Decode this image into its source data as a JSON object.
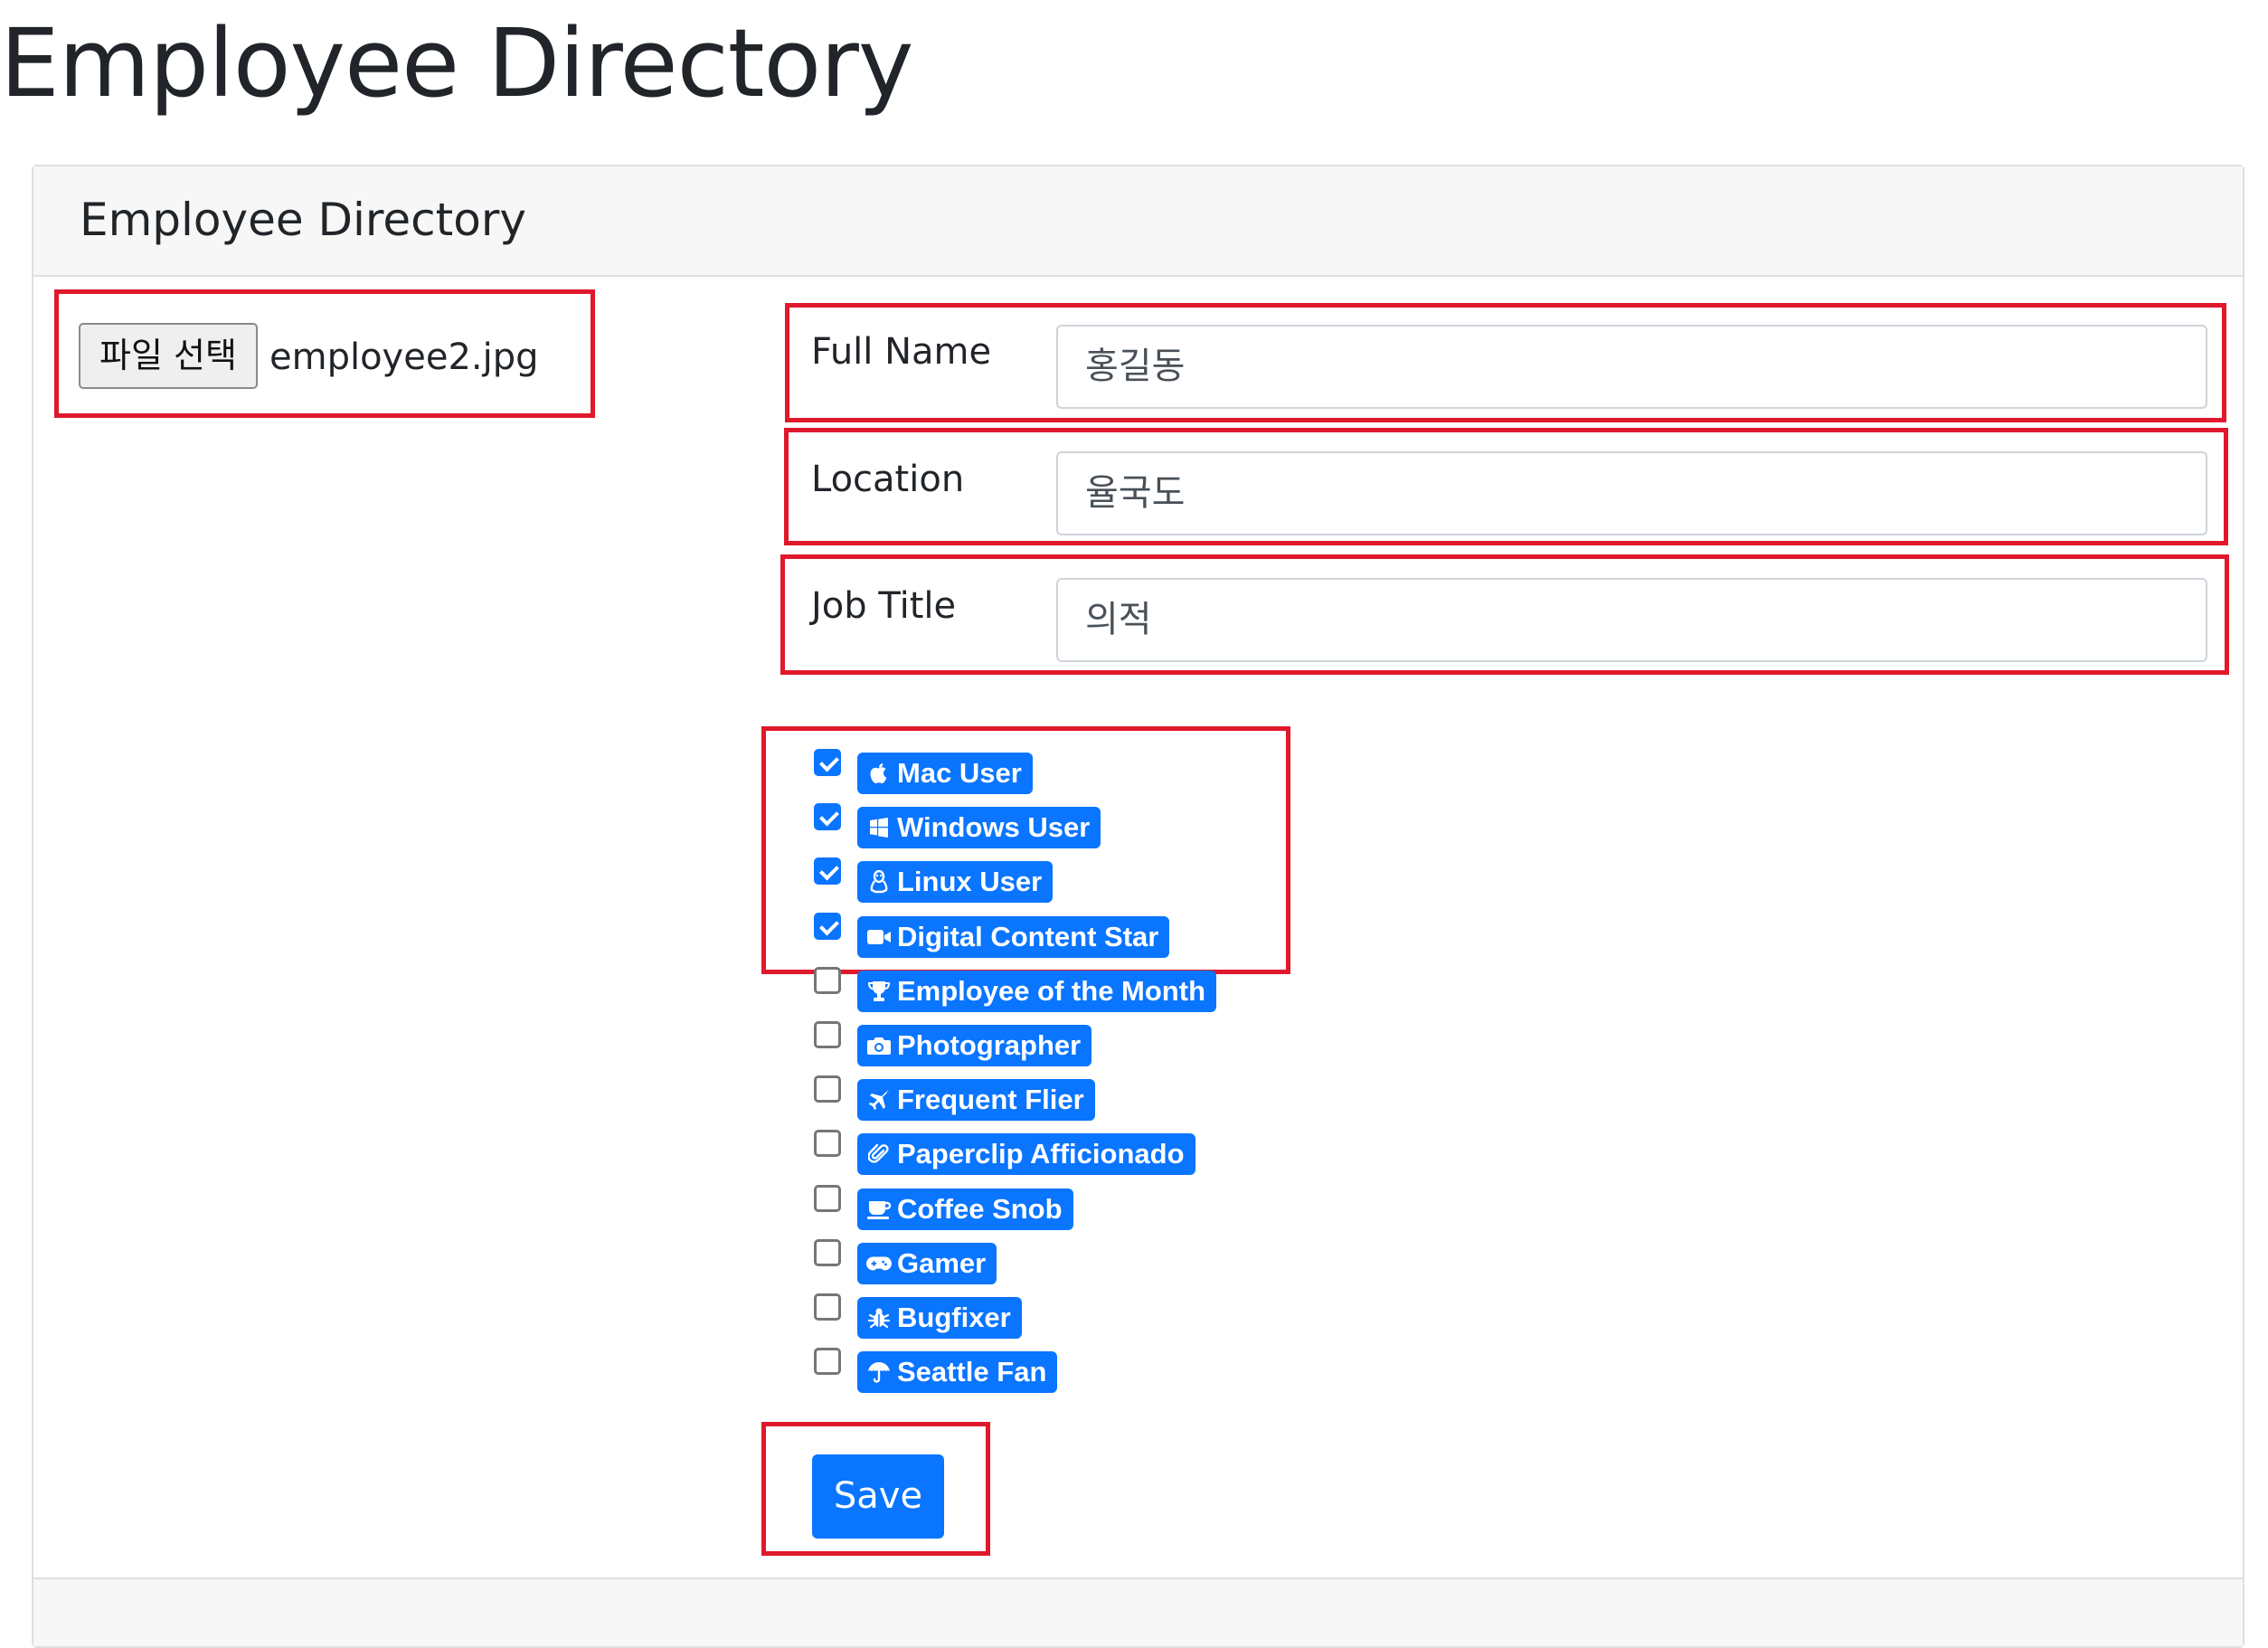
{
  "page": {
    "title": "Employee Directory"
  },
  "card": {
    "header_title": "Employee Directory"
  },
  "file_input": {
    "button_label": "파일 선택",
    "file_name": "employee2.jpg"
  },
  "form": {
    "fields": [
      {
        "label": "Full Name",
        "value": "홍길동"
      },
      {
        "label": "Location",
        "value": "율국도"
      },
      {
        "label": "Job Title",
        "value": "의적"
      }
    ]
  },
  "badges": [
    {
      "label": "Mac User",
      "icon": "apple-icon",
      "checked": true
    },
    {
      "label": "Windows User",
      "icon": "windows-icon",
      "checked": true
    },
    {
      "label": "Linux User",
      "icon": "linux-icon",
      "checked": true
    },
    {
      "label": "Digital Content Star",
      "icon": "video-camera-icon",
      "checked": true
    },
    {
      "label": "Employee of the Month",
      "icon": "trophy-icon",
      "checked": false
    },
    {
      "label": "Photographer",
      "icon": "camera-icon",
      "checked": false
    },
    {
      "label": "Frequent Flier",
      "icon": "plane-icon",
      "checked": false
    },
    {
      "label": "Paperclip Afficionado",
      "icon": "paperclip-icon",
      "checked": false
    },
    {
      "label": "Coffee Snob",
      "icon": "coffee-icon",
      "checked": false
    },
    {
      "label": "Gamer",
      "icon": "gamepad-icon",
      "checked": false
    },
    {
      "label": "Bugfixer",
      "icon": "bug-icon",
      "checked": false
    },
    {
      "label": "Seattle Fan",
      "icon": "umbrella-icon",
      "checked": false
    }
  ],
  "save_button": {
    "label": "Save"
  },
  "colors": {
    "primary": "#0a75ff",
    "highlight": "#e0182c",
    "header_bg": "#f7f7f7"
  }
}
